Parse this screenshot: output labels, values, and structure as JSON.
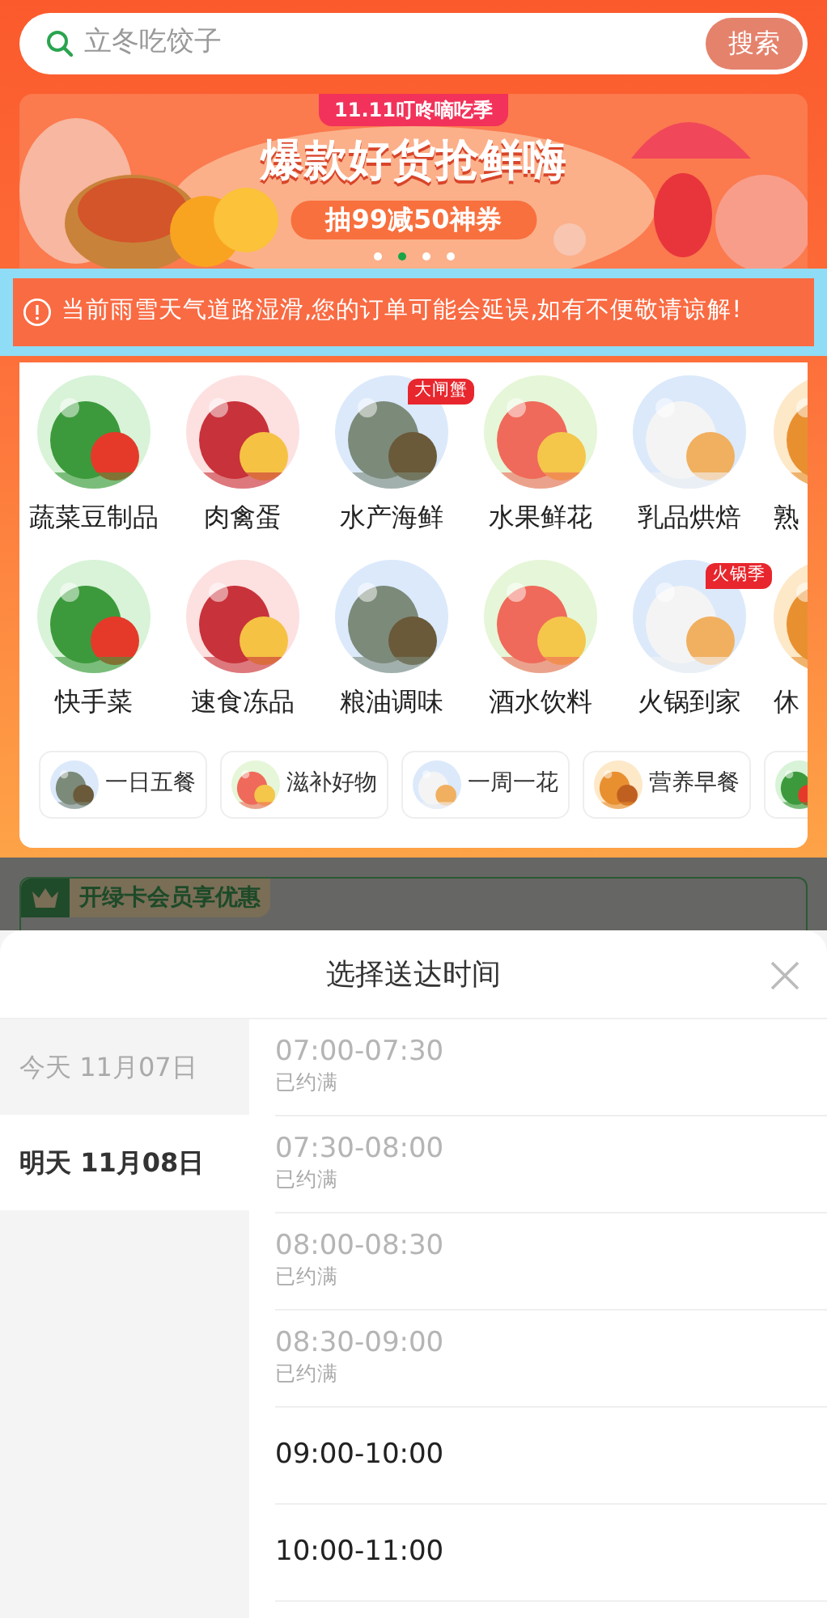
{
  "search": {
    "placeholder": "立冬吃饺子",
    "button": "搜索"
  },
  "banner": {
    "tag": "11.11叮咚嘀吃季",
    "headline": "爆款好货抢鲜嗨",
    "coupon": "抽99减50神券",
    "dots": [
      {
        "selected": false
      },
      {
        "selected": true
      },
      {
        "selected": false
      },
      {
        "selected": false
      }
    ]
  },
  "notice": {
    "text": "当前雨雪天气道路湿滑,您的订单可能会延误,如有不便敬请谅解!"
  },
  "categories": [
    [
      {
        "label": "蔬菜豆制品"
      },
      {
        "label": "肉禽蛋"
      },
      {
        "label": "水产海鲜",
        "badge": "大闸蟹"
      },
      {
        "label": "水果鲜花"
      },
      {
        "label": "乳品烘焙"
      },
      {
        "label": "熟"
      }
    ],
    [
      {
        "label": "快手菜"
      },
      {
        "label": "速食冻品"
      },
      {
        "label": "粮油调味"
      },
      {
        "label": "酒水饮料"
      },
      {
        "label": "火锅到家",
        "badge": "火锅季"
      },
      {
        "label": "休"
      }
    ]
  ],
  "chips": [
    {
      "label": "一日五餐"
    },
    {
      "label": "滋补好物"
    },
    {
      "label": "一周一花"
    },
    {
      "label": "营养早餐"
    },
    {
      "kind": "picture"
    }
  ],
  "member": {
    "text": "开绿卡会员享优惠"
  },
  "sheet": {
    "title": "选择送达时间",
    "days": [
      {
        "label": "今天 11月07日",
        "selected": false,
        "disabled": true
      },
      {
        "label": "明天 11月08日",
        "selected": true,
        "disabled": false
      }
    ],
    "slots": [
      {
        "time": "07:00-07:30",
        "status": "已约满",
        "disabled": true
      },
      {
        "time": "07:30-08:00",
        "status": "已约满",
        "disabled": true
      },
      {
        "time": "08:00-08:30",
        "status": "已约满",
        "disabled": true
      },
      {
        "time": "08:30-09:00",
        "status": "已约满",
        "disabled": true
      },
      {
        "time": "09:00-10:00",
        "disabled": false
      },
      {
        "time": "10:00-11:00",
        "disabled": false
      }
    ]
  }
}
